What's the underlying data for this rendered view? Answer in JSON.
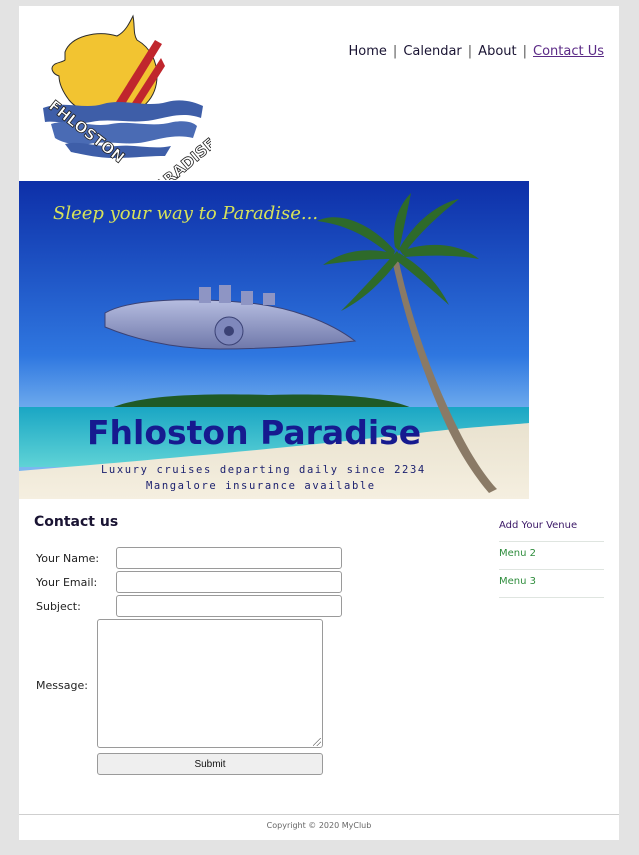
{
  "logo": {
    "text_left": "FHLOSTON",
    "text_right": "PARADISE"
  },
  "nav": {
    "items": [
      {
        "label": "Home"
      },
      {
        "label": "Calendar"
      },
      {
        "label": "About"
      },
      {
        "label": "Contact Us",
        "active": true
      }
    ],
    "separator": "|"
  },
  "banner": {
    "tagline": "Sleep your way to Paradise...",
    "title": "Fhloston Paradise",
    "line1": "Luxury cruises departing daily since 2234",
    "line2": "Mangalore insurance available"
  },
  "contact": {
    "heading": "Contact us",
    "name_label": "Your Name:",
    "email_label": "Your Email:",
    "subject_label": "Subject:",
    "message_label": "Message:",
    "submit_label": "Submit",
    "name_value": "",
    "email_value": "",
    "subject_value": "",
    "message_value": ""
  },
  "sidebar": {
    "items": [
      {
        "label": "Add Your Venue"
      },
      {
        "label": "Menu 2"
      },
      {
        "label": "Menu 3"
      }
    ]
  },
  "footer": {
    "copyright": "Copyright © 2020 MyClub"
  },
  "colors": {
    "page_bg": "#e3e3e3",
    "content_bg": "#ffffff",
    "nav_text": "#1a1433",
    "active_link": "#5b2a86",
    "menu_green": "#2f8d3d",
    "logo_yellow": "#f2c431",
    "logo_red": "#c0262d",
    "logo_blue": "#3e5ea8"
  }
}
